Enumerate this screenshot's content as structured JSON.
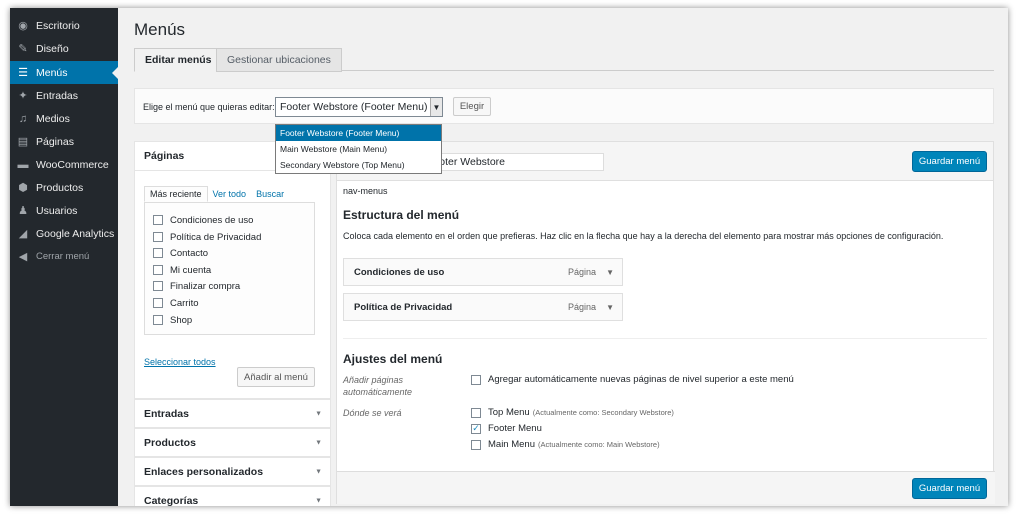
{
  "sidebar": {
    "items": [
      {
        "label": "Escritorio",
        "icon": "dashboard-icon",
        "glyph": "◉"
      },
      {
        "label": "Diseño",
        "icon": "brush-icon",
        "glyph": "✎"
      },
      {
        "label": "Menús",
        "icon": "menu-icon",
        "glyph": "☰"
      },
      {
        "label": "Entradas",
        "icon": "pin-icon",
        "glyph": "✦"
      },
      {
        "label": "Medios",
        "icon": "media-icon",
        "glyph": "♫"
      },
      {
        "label": "Páginas",
        "icon": "pages-icon",
        "glyph": "▤"
      },
      {
        "label": "WooCommerce",
        "icon": "woocommerce-icon",
        "glyph": "▬"
      },
      {
        "label": "Productos",
        "icon": "products-icon",
        "glyph": "⬢"
      },
      {
        "label": "Usuarios",
        "icon": "users-icon",
        "glyph": "♟"
      },
      {
        "label": "Google Analytics",
        "icon": "analytics-icon",
        "glyph": "◢"
      }
    ],
    "active_index": 2,
    "collapse": {
      "label": "Cerrar menú",
      "glyph": "◀"
    }
  },
  "header": {
    "title": "Menús"
  },
  "tabs": [
    {
      "label": "Editar menús",
      "active": true
    },
    {
      "label": "Gestionar ubicaciones",
      "active": false
    }
  ],
  "menu_select": {
    "label": "Elige el menú que quieras editar:",
    "selected": "Footer Webstore (Footer Menu)",
    "arrow_glyph": "▼",
    "button": "Elegir",
    "options": [
      {
        "label": "Footer Webstore (Footer Menu)",
        "selected": true
      },
      {
        "label": "Main Webstore (Main Menu)",
        "selected": false
      },
      {
        "label": "Secondary Webstore (Top Menu)",
        "selected": false
      }
    ]
  },
  "left": {
    "pages_title": "Páginas",
    "page_tabs": [
      "Más reciente",
      "Ver todo",
      "Buscar"
    ],
    "pages": [
      "Condiciones de uso",
      "Política de Privacidad",
      "Contacto",
      "Mi cuenta",
      "Finalizar compra",
      "Carrito",
      "Shop"
    ],
    "select_all": "Seleccionar todos",
    "add_button": "Añadir al menú",
    "sections": [
      "Entradas",
      "Productos",
      "Enlaces personalizados",
      "Categorías"
    ],
    "section_arrow": "▼"
  },
  "editor": {
    "menu_name": "Footer Webstore",
    "save_button": "Guardar menú",
    "nav_id": "nav-menus",
    "structure_title": "Estructura del menú",
    "structure_desc": "Coloca cada elemento en el orden que prefieras. Haz clic en la flecha que hay a la derecha del elemento para mostrar más opciones de configuración.",
    "items": [
      {
        "label": "Condiciones de uso",
        "type": "Página"
      },
      {
        "label": "Política de Privacidad",
        "type": "Página"
      }
    ],
    "item_arrow": "▼",
    "settings_title": "Ajustes del menú",
    "auto_add_label": "Añadir páginas automáticamente",
    "auto_add_text": "Agregar automáticamente nuevas páginas de nivel superior a este menú",
    "auto_add_checked": false,
    "location_label": "Dónde se verá",
    "locations": [
      {
        "label": "Top Menu",
        "note": "(Actualmente como: Secondary Webstore)",
        "checked": false
      },
      {
        "label": "Footer Menu",
        "note": "",
        "checked": true
      },
      {
        "label": "Main Menu",
        "note": "(Actualmente como: Main Webstore)",
        "checked": false
      }
    ],
    "check_glyph": "✓"
  },
  "colors": {
    "accent": "#0073aa",
    "sidebar_bg": "#23282d",
    "primary_button": "#0085ba"
  }
}
